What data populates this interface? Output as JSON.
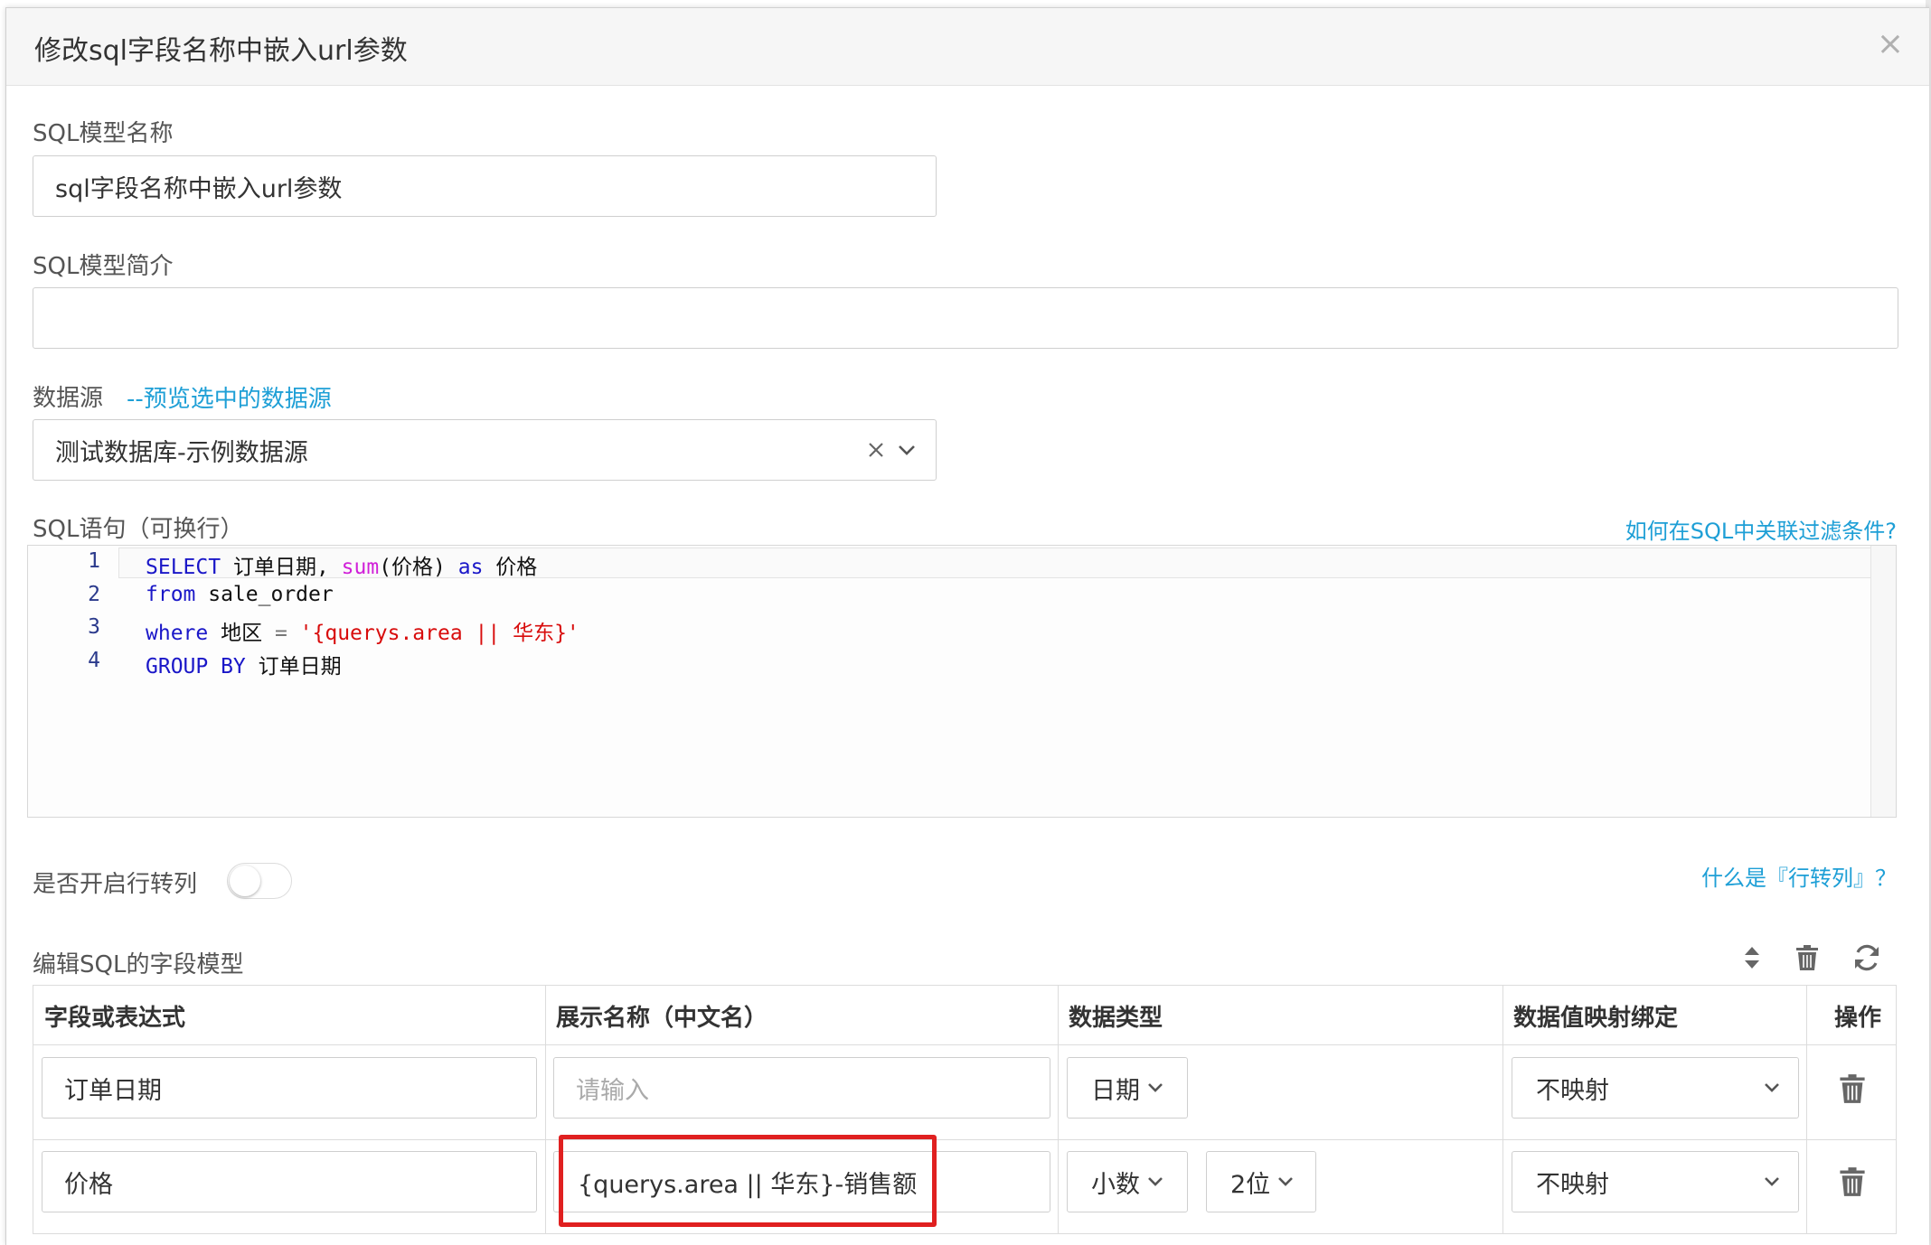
{
  "modal": {
    "title": "修改sql字段名称中嵌入url参数",
    "close_label": "×"
  },
  "form": {
    "name_label": "SQL模型名称",
    "name_value": "sql字段名称中嵌入url参数",
    "desc_label": "SQL模型简介",
    "desc_value": "",
    "datasource_label": "数据源",
    "datasource_link": "--预览选中的数据源",
    "datasource_value": "测试数据库-示例数据源",
    "sql_label": "SQL语句（可换行）",
    "sql_help_link": "如何在SQL中关联过滤条件?",
    "pivot_label": "是否开启行转列",
    "pivot_enabled": false,
    "pivot_help_link": "什么是『行转列』？",
    "fields_label": "编辑SQL的字段模型"
  },
  "editor": {
    "line_numbers": [
      "1",
      "2",
      "3",
      "4"
    ],
    "lines": [
      [
        {
          "t": "SELECT",
          "c": "kw"
        },
        {
          "t": " 订单日期, ",
          "c": ""
        },
        {
          "t": "sum",
          "c": "fn"
        },
        {
          "t": "(价格) ",
          "c": ""
        },
        {
          "t": "as",
          "c": "kw"
        },
        {
          "t": " 价格",
          "c": ""
        }
      ],
      [
        {
          "t": "from",
          "c": "kw"
        },
        {
          "t": " sale_order",
          "c": ""
        }
      ],
      [
        {
          "t": "where",
          "c": "kw"
        },
        {
          "t": " 地区 ",
          "c": ""
        },
        {
          "t": "=",
          "c": "op"
        },
        {
          "t": " ",
          "c": ""
        },
        {
          "t": "'{querys.area || 华东}'",
          "c": "str"
        }
      ],
      [
        {
          "t": "GROUP BY",
          "c": "kw"
        },
        {
          "t": " 订单日期",
          "c": ""
        }
      ]
    ]
  },
  "table": {
    "headers": [
      "字段或表达式",
      "展示名称（中文名）",
      "数据类型",
      "数据值映射绑定",
      "操作"
    ],
    "rows": [
      {
        "field": "订单日期",
        "display_name": "",
        "display_placeholder": "请输入",
        "data_type": "日期",
        "precision": null,
        "mapping": "不映射"
      },
      {
        "field": "价格",
        "display_name": "{querys.area || 华东}-销售额",
        "display_placeholder": "",
        "data_type": "小数",
        "precision": "2位",
        "mapping": "不映射"
      }
    ]
  },
  "icons": {
    "sort": "sort-icon",
    "delete_all": "trash-icon",
    "refresh": "refresh-icon",
    "row_delete": "trash-icon",
    "select_chevron": "chevron-down-icon",
    "select_clear": "clear-icon"
  },
  "colors": {
    "link": "#1e9fd6",
    "highlight_box": "#e02020",
    "keyword": "#1a17c8",
    "function": "#d01fd8",
    "string": "#d80c0c"
  }
}
